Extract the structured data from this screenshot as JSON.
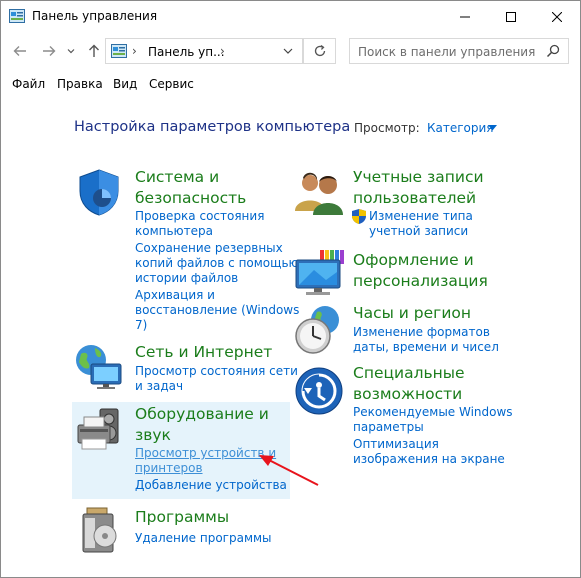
{
  "window": {
    "title": "Панель управления"
  },
  "address": {
    "path": "Панель уп...",
    "separator": "›"
  },
  "search": {
    "placeholder": "Поиск в панели управления"
  },
  "menu": {
    "items": [
      "Файл",
      "Правка",
      "Вид",
      "Сервис"
    ]
  },
  "content": {
    "heading": "Настройка параметров компьютера",
    "view_label": "Просмотр:",
    "view_value": "Категория"
  },
  "categories": {
    "system": {
      "title_line1": "Система и",
      "title_line2": "безопасность",
      "links": [
        [
          "Проверка состояния",
          "компьютера"
        ],
        [
          "Сохранение резервных",
          "копий файлов с помощью",
          "истории файлов"
        ],
        [
          "Архивация и",
          "восстановление (Windows",
          "7)"
        ]
      ]
    },
    "network": {
      "title": "Сеть и Интернет",
      "links": [
        [
          "Просмотр состояния сети",
          "и задач"
        ]
      ]
    },
    "hardware": {
      "title_line1": "Оборудование и",
      "title_line2": "звук",
      "links": [
        [
          "Просмотр устройств и",
          "принтеров"
        ],
        [
          "Добавление устройства"
        ]
      ]
    },
    "programs": {
      "title": "Программы",
      "links": [
        [
          "Удаление программы"
        ]
      ]
    },
    "accounts": {
      "title_line1": "Учетные записи",
      "title_line2": "пользователей",
      "links": [
        [
          "Изменение типа",
          "учетной записи"
        ]
      ]
    },
    "appearance": {
      "title_line1": "Оформление и",
      "title_line2": "персонализация"
    },
    "clock": {
      "title": "Часы и регион",
      "links": [
        [
          "Изменение форматов",
          "даты, времени и чисел"
        ]
      ]
    },
    "ease": {
      "title_line1": "Специальные",
      "title_line2": "возможности",
      "links": [
        [
          "Рекомендуемые Windows",
          "параметры"
        ],
        [
          "Оптимизация",
          "изображения на экране"
        ]
      ]
    }
  },
  "colors": {
    "heading": "#1e3287",
    "category_title": "#1b7d1b",
    "link": "#0066cc",
    "highlight": "#e5f3fb",
    "annotation_arrow": "#e8141c"
  }
}
